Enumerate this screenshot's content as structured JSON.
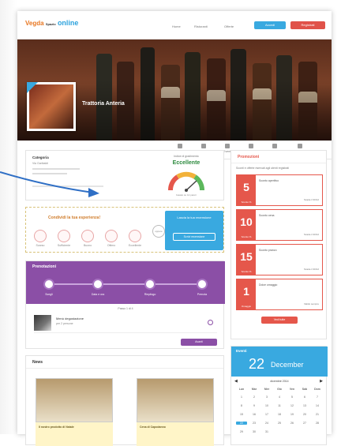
{
  "header": {
    "logo_main": "Vegda",
    "logo_small": "Spazio",
    "logo_accent": "online",
    "nav": [
      "Home",
      "Ristoranti",
      "Offerte"
    ],
    "btn_login": "Accedi",
    "btn_register": "Registrati"
  },
  "hero": {
    "restaurant_name": "Trattoria Anteria"
  },
  "subnav": [
    "Menu",
    "Promozioni",
    "Eventi",
    "News",
    "Recensioni",
    "Contatti"
  ],
  "breadcrumb": "Ristoranti › Trattoria Anteria",
  "info": {
    "category_label": "Categoria",
    "address": "Via Garibaldi",
    "gauge_label": "Indice di gradimento",
    "gauge_value": "Eccellente",
    "gauge_sub": "basato su 12 pareri"
  },
  "rating": {
    "title": "Condividi la tua esperienza!",
    "options": [
      "Scarso",
      "Sufficiente",
      "Buono",
      "Ottimo",
      "Eccellente"
    ],
    "cta_text": "Lascia la tua recensione",
    "cta_button": "Scrivi recensione",
    "or": "oppure"
  },
  "promo_steps": {
    "title": "Prenotazioni",
    "steps": [
      "Scegli",
      "Data e ora",
      "Riepilogo",
      "Prenota"
    ],
    "progress_text": "Passo 1 di 4",
    "item_title": "Menù degustazione",
    "item_sub": "per 2 persone",
    "button": "Avanti"
  },
  "news": {
    "title": "News",
    "items": [
      {
        "title": "Il nostro prodotto di Natale"
      },
      {
        "title": "Cena di Capodanno"
      }
    ]
  },
  "sidebar": {
    "title": "Promozioni",
    "intro": "Sconti e offerte riservati agli utenti registrati",
    "items": [
      {
        "num": "5",
        "sub": "Sconto %",
        "text": "Sconto aperitivo",
        "date": "Scade il 30/12"
      },
      {
        "num": "10",
        "sub": "Sconto %",
        "text": "Sconto cena",
        "date": "Scade il 30/12"
      },
      {
        "num": "15",
        "sub": "Sconto %",
        "text": "Sconto pranzo",
        "date": "Scade il 30/12"
      },
      {
        "num": "1",
        "sub": "Omaggio",
        "text": "Dolce omaggio",
        "date": "Valido sempre"
      }
    ],
    "button": "Vedi tutte"
  },
  "calendar": {
    "title": "Eventi",
    "day": "22",
    "month": "December",
    "nav_title": "dicembre 2014",
    "weekdays": [
      "Lun",
      "Mar",
      "Mer",
      "Gio",
      "Ven",
      "Sab",
      "Dom"
    ],
    "days": [
      "1",
      "2",
      "3",
      "4",
      "5",
      "6",
      "7",
      "8",
      "9",
      "10",
      "11",
      "12",
      "13",
      "14",
      "15",
      "16",
      "17",
      "18",
      "19",
      "20",
      "21",
      "22",
      "23",
      "24",
      "25",
      "26",
      "27",
      "28",
      "29",
      "30",
      "31"
    ]
  },
  "colors": {
    "accent_blue": "#39a9e0",
    "accent_red": "#e5574b",
    "purple": "#8b4fa6",
    "arrow": "#2f6fc5"
  }
}
